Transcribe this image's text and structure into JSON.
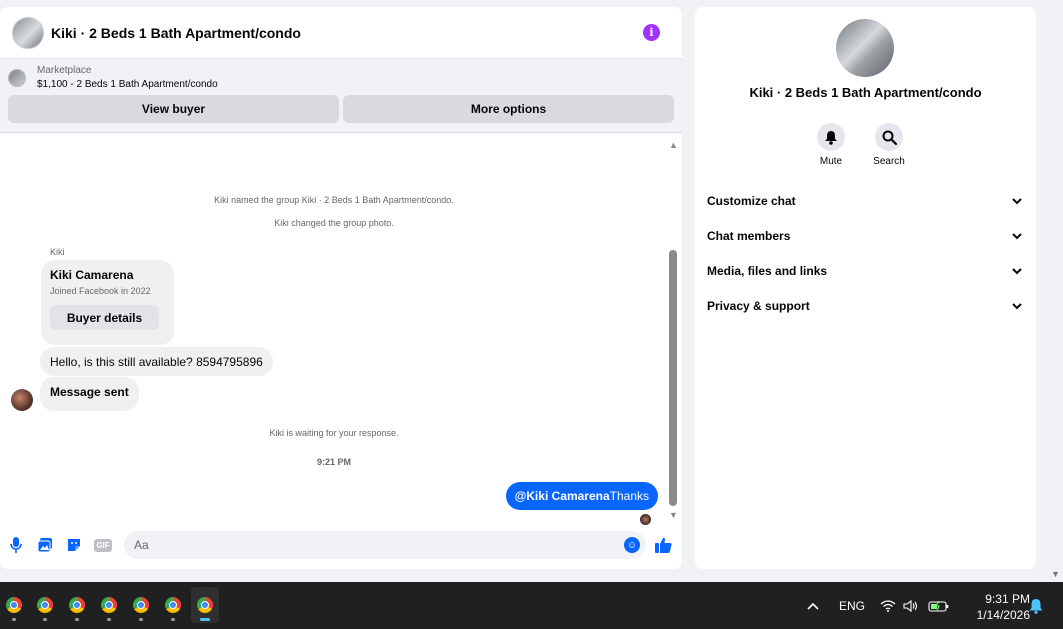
{
  "chat": {
    "title": "Kiki · 2 Beds 1 Bath Apartment/condo",
    "info_icon": "i"
  },
  "listing": {
    "label": "Marketplace",
    "price_title": "$1,100 - 2 Beds 1 Bath Apartment/condo",
    "view_buyer": "View buyer",
    "more_options": "More options"
  },
  "messages": {
    "sys1": "Kiki named the group Kiki · 2 Beds 1 Bath Apartment/condo.",
    "sys2": "Kiki changed the group photo.",
    "sender": "Kiki",
    "card_name": "Kiki Camarena",
    "card_sub": "Joined Facebook in 2022",
    "card_button": "Buyer details",
    "msg1": "Hello, is this still available? 8594795896",
    "msg2": "Message sent",
    "sys3": "Kiki is waiting for your response.",
    "time": "9:21 PM",
    "out_mention": "@Kiki Camarena",
    "out_text": "Thanks"
  },
  "composer": {
    "placeholder": "Aa",
    "gif": "GIF"
  },
  "side": {
    "title": "Kiki · 2 Beds 1 Bath Apartment/condo",
    "mute": "Mute",
    "search": "Search",
    "sections": [
      "Customize chat",
      "Chat members",
      "Media, files and links",
      "Privacy & support"
    ]
  },
  "taskbar": {
    "language": "ENG",
    "time": "9:31 PM",
    "date": "1/14/2026"
  },
  "colors": {
    "accent": "#0866ff",
    "info": "#a033ff"
  }
}
